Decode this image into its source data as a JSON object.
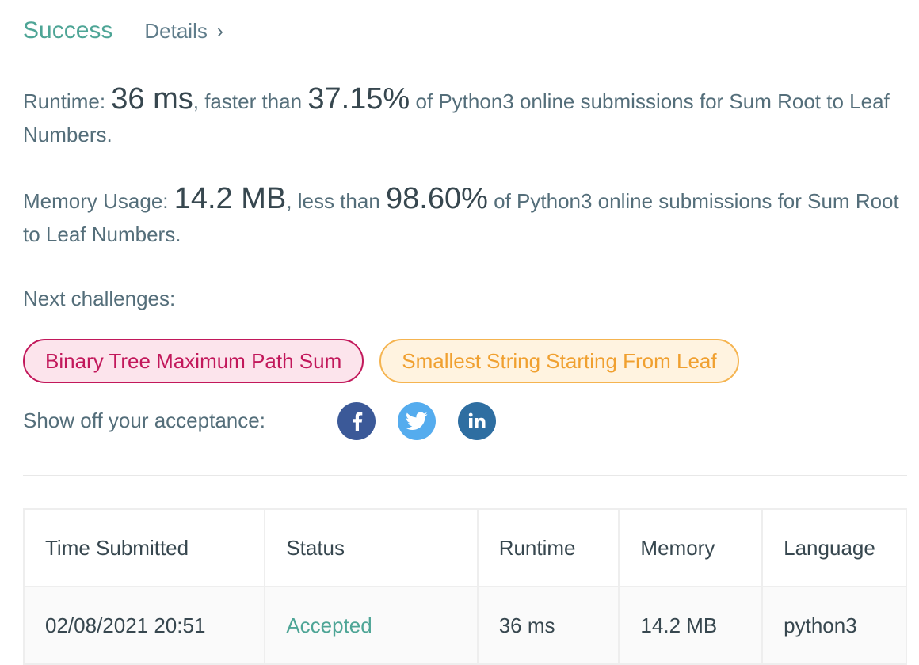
{
  "header": {
    "status": "Success",
    "details_label": "Details"
  },
  "runtime": {
    "label": "Runtime:",
    "value": "36 ms",
    "mid": ", faster than",
    "percent": "37.15%",
    "tail": "of Python3 online submissions for Sum Root to Leaf Numbers."
  },
  "memory": {
    "label": "Memory Usage:",
    "value": "14.2 MB",
    "mid": ", less than",
    "percent": "98.60%",
    "tail": "of Python3 online submissions for Sum Root to Leaf Numbers."
  },
  "next": {
    "label": "Next challenges:",
    "challenges": [
      {
        "title": "Binary Tree Maximum Path Sum",
        "difficulty_color": "#c2185b"
      },
      {
        "title": "Smallest String Starting From Leaf",
        "difficulty_color": "#f0a030"
      }
    ]
  },
  "share": {
    "label": "Show off your acceptance:",
    "icons": [
      "facebook-icon",
      "twitter-icon",
      "linkedin-icon"
    ]
  },
  "table": {
    "headers": [
      "Time Submitted",
      "Status",
      "Runtime",
      "Memory",
      "Language"
    ],
    "rows": [
      [
        "02/08/2021 20:51",
        "Accepted",
        "36 ms",
        "14.2 MB",
        "python3"
      ]
    ]
  },
  "colors": {
    "success": "#4ea596",
    "text": "#546e7a",
    "facebook": "#3b5998",
    "twitter": "#55acee",
    "linkedin": "#2e6ea1"
  }
}
